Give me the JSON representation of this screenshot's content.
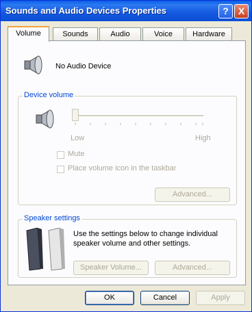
{
  "window": {
    "title": "Sounds and Audio Devices Properties",
    "help_label": "?",
    "close_label": "X"
  },
  "tabs": [
    "Volume",
    "Sounds",
    "Audio",
    "Voice",
    "Hardware"
  ],
  "device": {
    "name": "No Audio Device"
  },
  "device_volume": {
    "label": "Device volume",
    "low": "Low",
    "high": "High",
    "mute": "Mute",
    "taskbar": "Place volume icon in the taskbar",
    "advanced": "Advanced..."
  },
  "speaker": {
    "label": "Speaker settings",
    "text": "Use the settings below to change individual speaker volume and other settings.",
    "volume_btn": "Speaker Volume...",
    "advanced_btn": "Advanced..."
  },
  "buttons": {
    "ok": "OK",
    "cancel": "Cancel",
    "apply": "Apply"
  }
}
